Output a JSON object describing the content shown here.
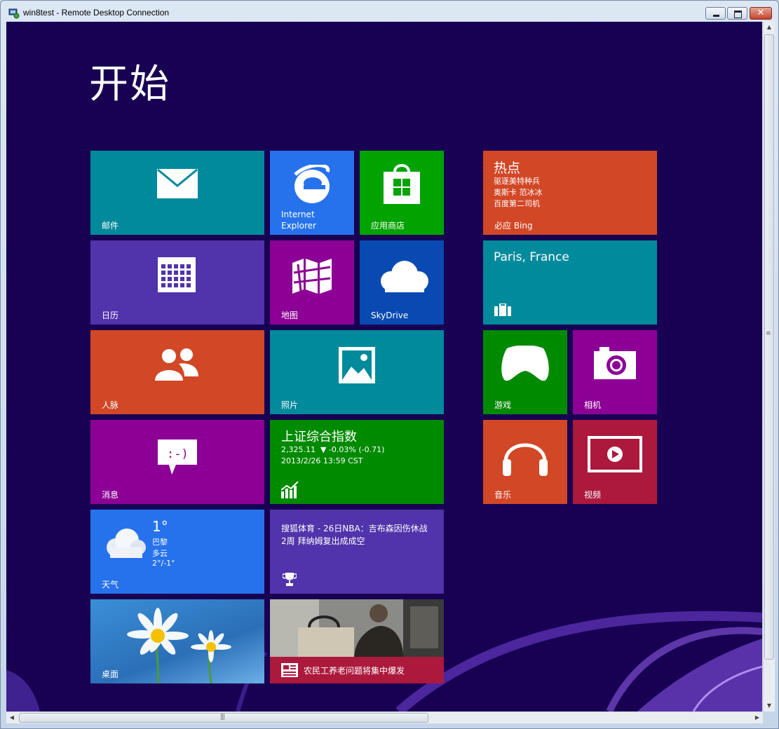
{
  "window": {
    "title": "win8test - Remote Desktop Connection",
    "close_glyph": "✕",
    "icon": "remote-desktop-icon"
  },
  "start": {
    "title": "开始"
  },
  "tiles": {
    "mail": {
      "label": "邮件",
      "color": "#008a9c",
      "icon": "mail-icon"
    },
    "ie": {
      "label_line1": "Internet",
      "label_line2": "Explorer",
      "color": "#2672ec",
      "icon": "internet-explorer-icon"
    },
    "store": {
      "label": "应用商店",
      "color": "#00a300",
      "icon": "store-icon"
    },
    "bing": {
      "heading": "热点",
      "items": [
        "驱逐美特种兵",
        "奥斯卡 范冰冰",
        "百度第二司机"
      ],
      "label": "必应 Bing",
      "color": "#d24726"
    },
    "calendar": {
      "label": "日历",
      "color": "#5133ab",
      "icon": "calendar-icon"
    },
    "maps": {
      "label": "地图",
      "color": "#8c0095",
      "icon": "maps-icon"
    },
    "skydrive": {
      "label": "SkyDrive",
      "color": "#094ab2",
      "icon": "cloud-icon"
    },
    "travel": {
      "heading": "Paris, France",
      "color": "#008a9c",
      "icon": "suitcase-icon"
    },
    "people": {
      "label": "人脉",
      "color": "#d24726",
      "icon": "people-icon"
    },
    "photos": {
      "label": "照片",
      "color": "#008a9c",
      "icon": "photo-icon"
    },
    "games": {
      "label": "游戏",
      "color": "#008a00",
      "icon": "xbox-controller-icon"
    },
    "camera": {
      "label": "相机",
      "color": "#8c0095",
      "icon": "camera-icon"
    },
    "messaging": {
      "label": "消息",
      "color": "#8c0095",
      "icon": "chat-bubble-icon"
    },
    "finance": {
      "heading": "上证综合指数",
      "value": "2,325.11",
      "change": "▼ -0.03% (-0.71)",
      "timestamp": "2013/2/26 13:59 CST",
      "color": "#008a00",
      "icon": "chart-icon"
    },
    "music": {
      "label": "音乐",
      "color": "#d24726",
      "icon": "headphones-icon"
    },
    "video": {
      "label": "视频",
      "color": "#ac193d",
      "icon": "video-icon"
    },
    "weather": {
      "temp": "1°",
      "city": "巴黎",
      "condition": "多云",
      "range": "2°/-1°",
      "label": "天气",
      "color": "#2672ec",
      "icon": "cloud-icon"
    },
    "sports": {
      "headline_line1": "搜狐体育 - 26日NBA：吉布森因伤休战",
      "headline_line2": "2周 拜纳姆复出成成空",
      "color": "#5133ab",
      "icon": "trophy-icon"
    },
    "desktop": {
      "label": "桌面",
      "color": "#3a8fd6",
      "icon": "daisy-wallpaper"
    },
    "news": {
      "headline": "农民工养老问题将集中爆发",
      "color": "#ac193d",
      "icon": "news-icon"
    }
  }
}
